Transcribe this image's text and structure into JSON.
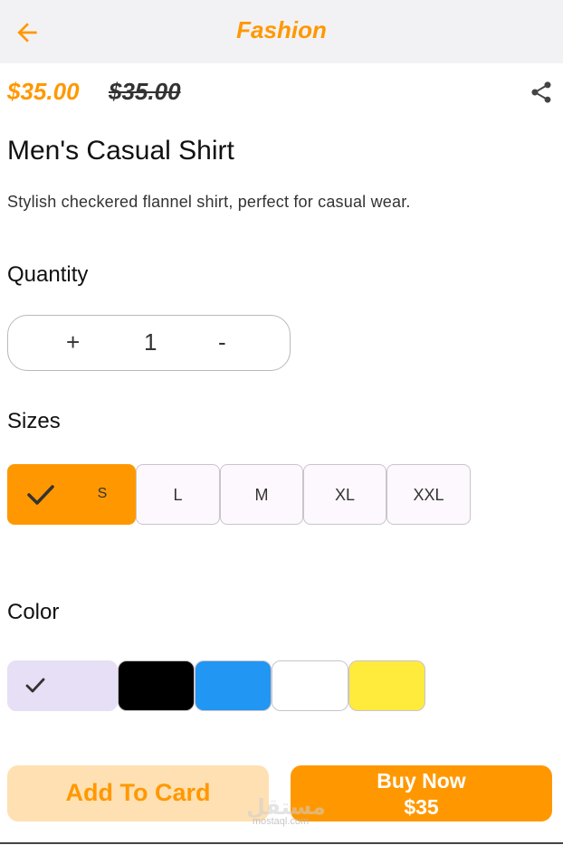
{
  "appbar": {
    "title": "Fashion"
  },
  "product": {
    "price": "$35.00",
    "old_price": "$35.00",
    "title": "Men's Casual Shirt",
    "description": "Stylish checkered flannel shirt, perfect for casual wear."
  },
  "quantity": {
    "heading": "Quantity",
    "plus": "+",
    "value": "1",
    "minus": "-"
  },
  "sizes": {
    "heading": "Sizes",
    "options": [
      "S",
      "L",
      "M",
      "XL",
      "XXL"
    ],
    "selected": "S"
  },
  "colors": {
    "heading": "Color",
    "options": [
      "#e6dff5",
      "#000000",
      "#2196f3",
      "#ffffff",
      "#ffeb3b"
    ],
    "selected_index": 0
  },
  "actions": {
    "add_label": "Add To Card",
    "buy_label": "Buy Now",
    "buy_price": "$35"
  },
  "watermark": {
    "text": "mostaql.com"
  },
  "theme": {
    "accent": "#ff9800"
  }
}
